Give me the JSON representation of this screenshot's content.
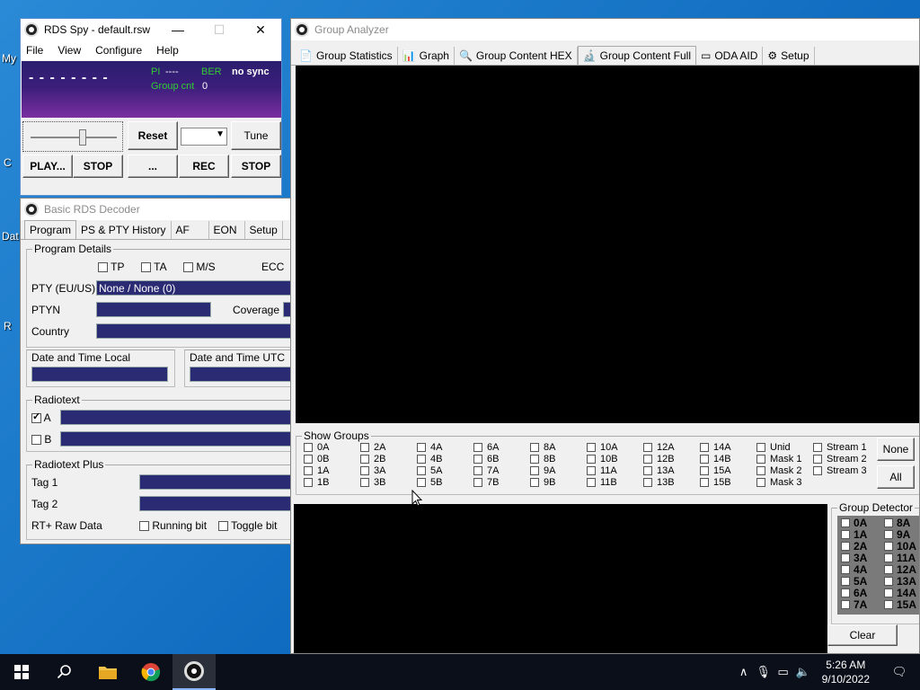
{
  "desktop": {
    "icon_labels": [
      "My",
      "C",
      "Dat",
      "R"
    ]
  },
  "rdsspy": {
    "title": "RDS Spy - default.rsw",
    "menu": [
      "File",
      "View",
      "Configure",
      "Help"
    ],
    "ps_display": "- - - - - - - -",
    "pi_label": "PI",
    "pi_value": "----",
    "ber_label": "BER",
    "sync_status": "no sync",
    "group_cnt_label": "Group cnt",
    "group_cnt_value": "0",
    "buttons": {
      "reset": "Reset",
      "tune": "Tune",
      "play": "PLAY...",
      "stop": "STOP",
      "dots": "...",
      "rec": "REC",
      "stop2": "STOP"
    }
  },
  "decoder": {
    "title": "Basic RDS Decoder",
    "tabs": [
      "Program",
      "PS & PTY History",
      "AF",
      "EON",
      "Setup"
    ],
    "program_details": "Program Details",
    "tp": "TP",
    "ta": "TA",
    "ms": "M/S",
    "ecc": "ECC",
    "pty_label": "PTY (EU/US)",
    "pty_value": "None / None (0)",
    "ptyn_label": "PTYN",
    "coverage_label": "Coverage",
    "country_label": "Country",
    "dt_local": "Date and Time Local",
    "dt_utc": "Date and Time UTC",
    "radiotext": "Radiotext",
    "rt_a": "A",
    "rt_b": "B",
    "rtplus": "Radiotext Plus",
    "tag1": "Tag 1",
    "tag2": "Tag 2",
    "rt_raw": "RT+ Raw Data",
    "running_bit": "Running bit",
    "toggle_bit": "Toggle bit"
  },
  "analyzer": {
    "title": "Group Analyzer",
    "tabs": [
      {
        "label": "Group Statistics",
        "icon": "document-icon"
      },
      {
        "label": "Graph",
        "icon": "graph-icon"
      },
      {
        "label": "Group Content HEX",
        "icon": "magnifier-icon"
      },
      {
        "label": "Group Content Full",
        "icon": "microscope-icon"
      },
      {
        "label": "ODA AID",
        "icon": "card-icon"
      },
      {
        "label": "Setup",
        "icon": "gear-icon"
      }
    ],
    "show_groups_title": "Show Groups",
    "groups_col": [
      [
        "0A",
        "0B",
        "1A",
        "1B"
      ],
      [
        "2A",
        "2B",
        "3A",
        "3B"
      ],
      [
        "4A",
        "4B",
        "5A",
        "5B"
      ],
      [
        "6A",
        "6B",
        "7A",
        "7B"
      ],
      [
        "8A",
        "8B",
        "9A",
        "9B"
      ],
      [
        "10A",
        "10B",
        "11A",
        "11B"
      ],
      [
        "12A",
        "12B",
        "13A",
        "13B"
      ],
      [
        "14A",
        "14B",
        "15A",
        "15B"
      ],
      [
        "Unid",
        "Mask 1",
        "Mask 2",
        "Mask 3"
      ],
      [
        "Stream 1",
        "Stream 2",
        "Stream 3"
      ]
    ],
    "none_button": "None",
    "all_button": "All",
    "detector_title": "Group Detector",
    "detector_left": [
      "0A",
      "1A",
      "2A",
      "3A",
      "4A",
      "5A",
      "6A",
      "7A"
    ],
    "detector_right": [
      "8A",
      "9A",
      "10A",
      "11A",
      "12A",
      "13A",
      "14A",
      "15A"
    ],
    "clear_button": "Clear"
  },
  "taskbar": {
    "time": "5:26 AM",
    "date": "9/10/2022"
  }
}
